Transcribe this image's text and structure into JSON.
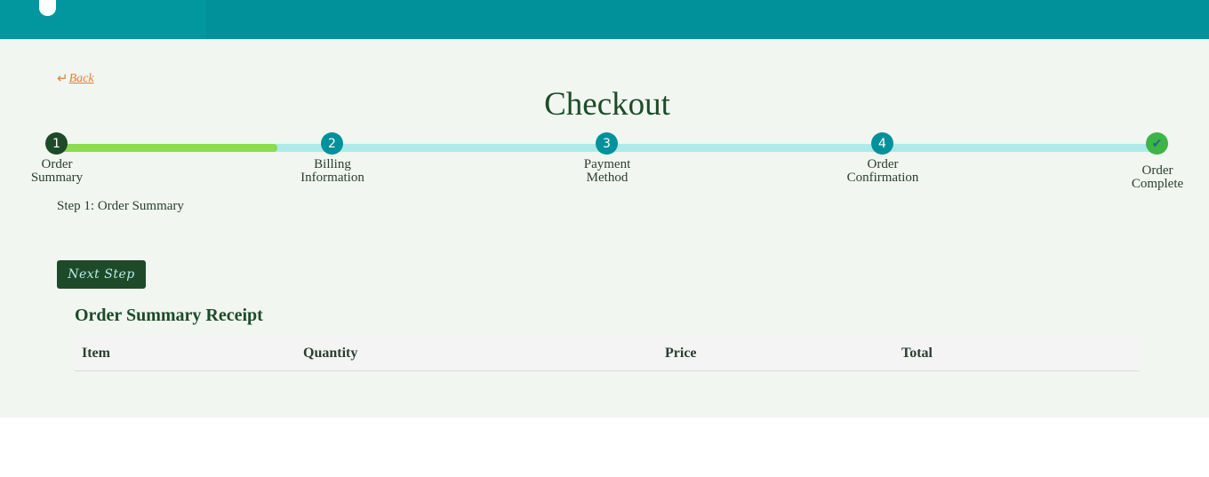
{
  "header": {
    "logo_icon": "leaf-icon",
    "bg_color": "#00919a"
  },
  "back": {
    "arrow": "↵",
    "label": "Back"
  },
  "page_title": "Checkout",
  "progress": {
    "fill_fraction": 0.2,
    "fill_color": "#8bdc4f",
    "track_color": "#aeeaea",
    "steps": [
      {
        "marker": "1",
        "label_line1": "Order",
        "label_line2": "Summary",
        "state": "active"
      },
      {
        "marker": "2",
        "label_line1": "Billing",
        "label_line2": "Information",
        "state": "pending"
      },
      {
        "marker": "3",
        "label_line1": "Payment",
        "label_line2": "Method",
        "state": "pending"
      },
      {
        "marker": "4",
        "label_line1": "Order",
        "label_line2": "Confirmation",
        "state": "pending"
      },
      {
        "marker": "✔",
        "label_line1": "Order",
        "label_line2": "Complete",
        "state": "done"
      }
    ]
  },
  "step_caption": "Step 1: Order Summary",
  "next_button": "Next Step",
  "receipt": {
    "title": "Order Summary Receipt",
    "columns": [
      "Item",
      "Quantity",
      "Price",
      "Total"
    ]
  }
}
